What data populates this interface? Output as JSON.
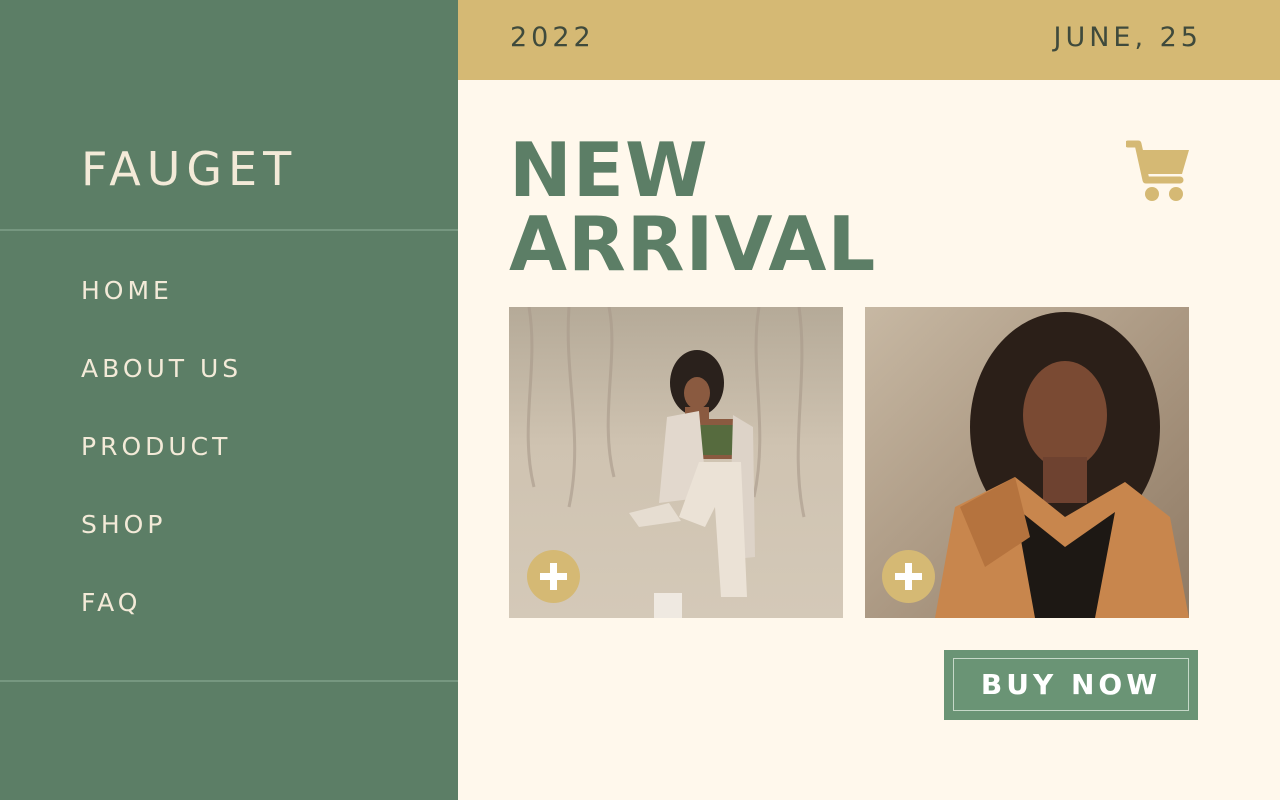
{
  "brand": {
    "name": "FAUGET"
  },
  "nav": {
    "items": [
      {
        "label": "HOME"
      },
      {
        "label": "ABOUT US"
      },
      {
        "label": "PRODUCT"
      },
      {
        "label": "SHOP"
      },
      {
        "label": "FAQ"
      }
    ]
  },
  "topbar": {
    "year": "2022",
    "date": "JUNE, 25"
  },
  "main": {
    "headline_line1": "NEW",
    "headline_line2": "ARRIVAL",
    "cart_icon": "shopping-cart-icon",
    "products": [
      {
        "image": "model in beige suit photo",
        "add_icon": "plus-icon"
      },
      {
        "image": "model in orange hoodie photo",
        "add_icon": "plus-icon"
      }
    ],
    "buy_label": "BUY NOW"
  },
  "colors": {
    "sidebar": "#5c7e66",
    "topbar": "#d5b974",
    "background": "#fff8ec",
    "accent_gold": "#d5b974",
    "button": "#6a9475"
  }
}
